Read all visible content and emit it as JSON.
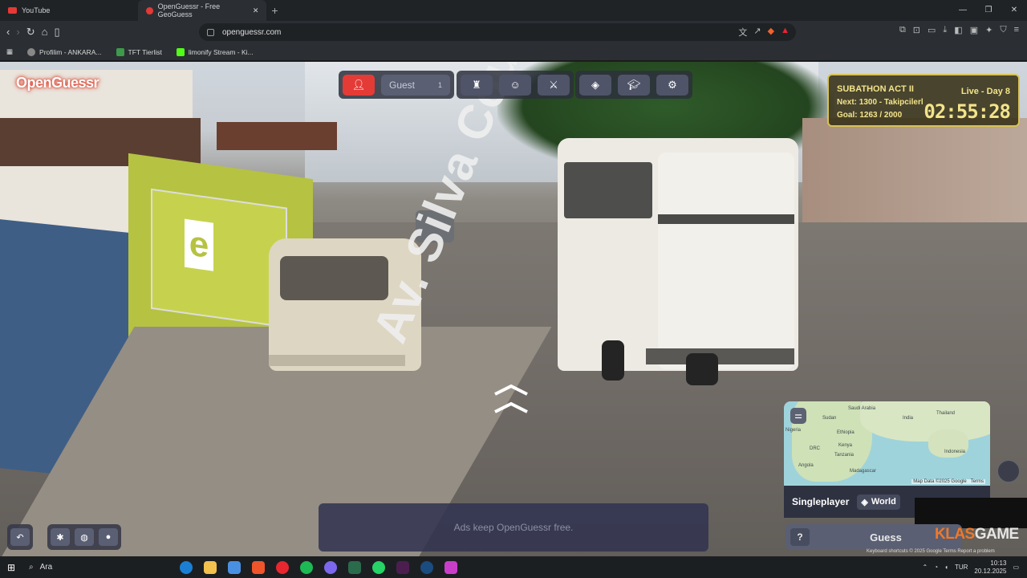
{
  "browser": {
    "tabs": [
      {
        "title": "YouTube"
      },
      {
        "title": "OpenGuessr - Free GeoGuess"
      }
    ],
    "new_tab": "+",
    "url": "openguessr.com",
    "bookmarks": [
      {
        "label": "Profilim - ANKARA..."
      },
      {
        "label": "TFT Tierlist"
      },
      {
        "label": "limonify Stream - Ki..."
      }
    ]
  },
  "game": {
    "logo": "OpenGuessr",
    "player": {
      "name": "Guest",
      "count": "1"
    },
    "street_label": "Av. Silva Couto",
    "ad_text": "Ads keep OpenGuessr free.",
    "mode": "Singleplayer",
    "region": "World",
    "guess_help": "?",
    "guess_label": "Guess",
    "map": {
      "labels": [
        "Sudan",
        "Saudi Arabia",
        "India",
        "Thailand",
        "Nigeria",
        "Ethiopia",
        "Kenya",
        "DRC",
        "Tanzania",
        "Angola",
        "Madagascar",
        "Indonesia"
      ],
      "attribution": "Map Data ©2025 Google",
      "terms": "Terms"
    }
  },
  "subathon": {
    "title": "SUBATHON ACT II",
    "live": "Live - Day 8",
    "next": "Next: 1300 - Takipcilerle",
    "goal": "Goal: 1263 / 2000",
    "timer": "02:55:28"
  },
  "overlay": {
    "brand_a": "KLAS",
    "brand_b": "GAME",
    "shortcuts": "Keyboard shortcuts   © 2025 Google   Terms   Report a problem"
  },
  "taskbar": {
    "search": "Ara",
    "lang": "TUR",
    "time": "10:13",
    "date": "20.12.2025"
  },
  "colors": {
    "accent_red": "#e53b37",
    "subathon_gold": "#d7c254",
    "panel": "#2e3140"
  }
}
